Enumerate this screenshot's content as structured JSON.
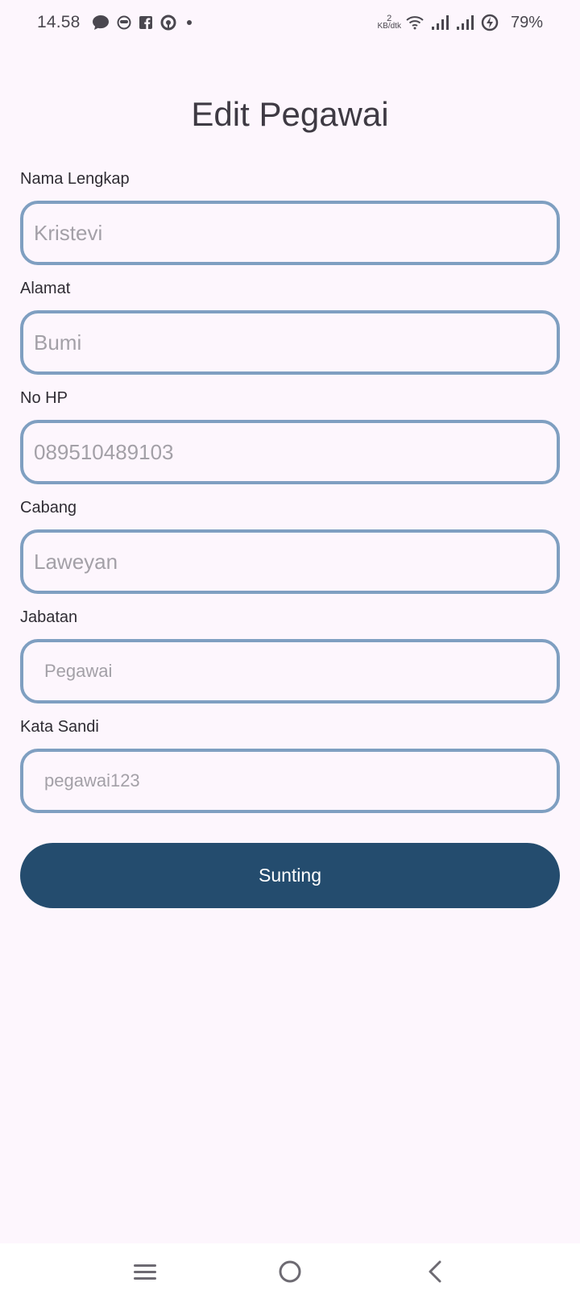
{
  "status_bar": {
    "time": "14.58",
    "net_speed_value": "2",
    "net_speed_unit": "KB/dtk",
    "battery_percent": "79%"
  },
  "page": {
    "title": "Edit Pegawai"
  },
  "form": {
    "fields": [
      {
        "label": "Nama Lengkap",
        "placeholder": "Kristevi"
      },
      {
        "label": "Alamat",
        "placeholder": "Bumi"
      },
      {
        "label": "No HP",
        "placeholder": "089510489103"
      },
      {
        "label": "Cabang",
        "placeholder": "Laweyan"
      },
      {
        "label": "Jabatan",
        "placeholder": "Pegawai"
      },
      {
        "label": "Kata Sandi",
        "placeholder": "pegawai123"
      }
    ],
    "submit_label": "Sunting"
  },
  "colors": {
    "background": "#fdf6fd",
    "field_border": "#7f9fc1",
    "button": "#244c6e"
  },
  "icons": {
    "status_left": [
      "chat-bubble-icon",
      "emoji-face-icon",
      "facebook-icon",
      "circle-app-icon"
    ],
    "status_right": [
      "wifi-icon",
      "signal-icon",
      "signal-icon",
      "battery-charging-icon"
    ],
    "nav": [
      "menu-icon",
      "home-icon",
      "back-icon"
    ]
  }
}
